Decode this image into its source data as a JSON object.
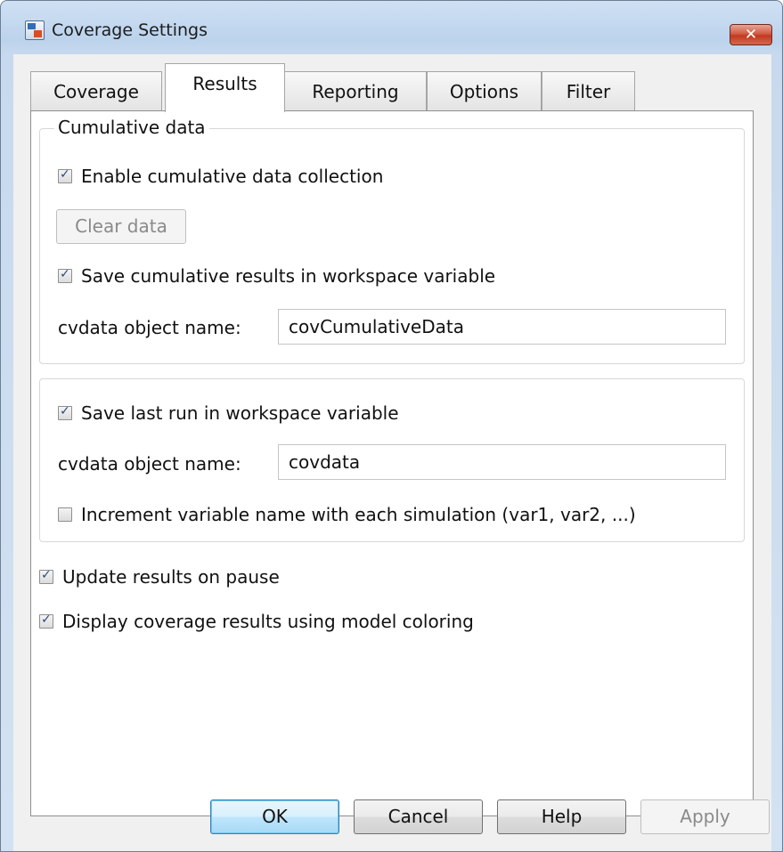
{
  "window": {
    "title": "Coverage Settings",
    "app_icon": "simulink-model-icon",
    "close_label": "✕"
  },
  "tabs": [
    {
      "label": "Coverage",
      "active": false
    },
    {
      "label": "Results",
      "active": true
    },
    {
      "label": "Reporting",
      "active": false
    },
    {
      "label": "Options",
      "active": false
    },
    {
      "label": "Filter",
      "active": false
    }
  ],
  "cumulative": {
    "legend": "Cumulative data",
    "enable_label": "Enable cumulative data collection",
    "enable_checked": true,
    "clear_label": "Clear data",
    "save_label": "Save cumulative results in workspace variable",
    "save_checked": true,
    "name_label": "cvdata object name:",
    "name_value": "covCumulativeData"
  },
  "last_run": {
    "save_label": "Save last run in workspace variable",
    "save_checked": true,
    "name_label": "cvdata object name:",
    "name_value": "covdata",
    "increment_label": "Increment variable name with each simulation (var1, var2, ...)",
    "increment_checked": false
  },
  "options": {
    "update_label": "Update results on pause",
    "update_checked": true,
    "display_label": "Display coverage results using model coloring",
    "display_checked": true
  },
  "buttons": {
    "ok": "OK",
    "cancel": "Cancel",
    "help": "Help",
    "apply": "Apply"
  },
  "colors": {
    "default_button": "#bee6fd",
    "close_button": "#c7432a"
  }
}
